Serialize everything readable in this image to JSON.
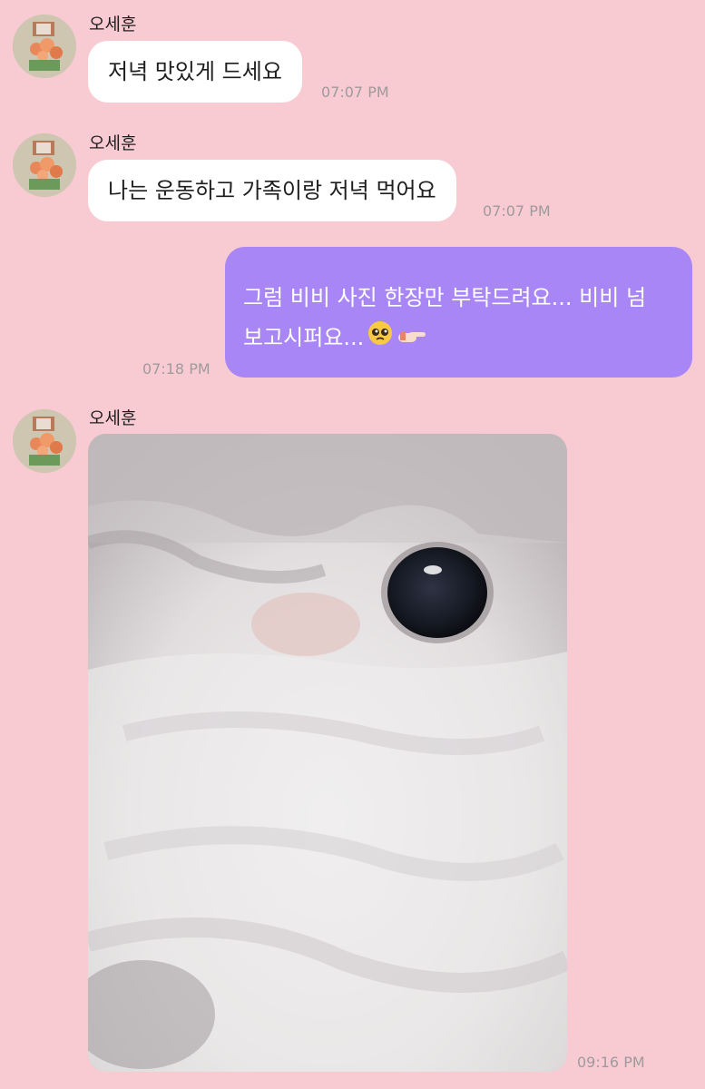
{
  "messages": [
    {
      "sender": "오세훈",
      "text": "저녁 맛있게 드세요",
      "time": "07:07 PM"
    },
    {
      "sender": "오세훈",
      "text": "나는 운동하고 가족이랑 저녁 먹어요",
      "time": "07:07 PM"
    },
    {
      "text_line1": "그럼 비비 사진 한장만 부탁드려요... 비비 넘",
      "text_line2": "보고시퍼요...",
      "emojis": [
        "pleading-face-emoji",
        "pointing-hand-emoji"
      ],
      "time": "07:18 PM"
    },
    {
      "sender": "오세훈",
      "attachment": "photo",
      "time": "09:16 PM"
    }
  ],
  "colors": {
    "background": "#f8cbd3",
    "incoming_bubble": "#ffffff",
    "outgoing_bubble": "#a886f6",
    "timestamp": "#9f9a9c"
  }
}
